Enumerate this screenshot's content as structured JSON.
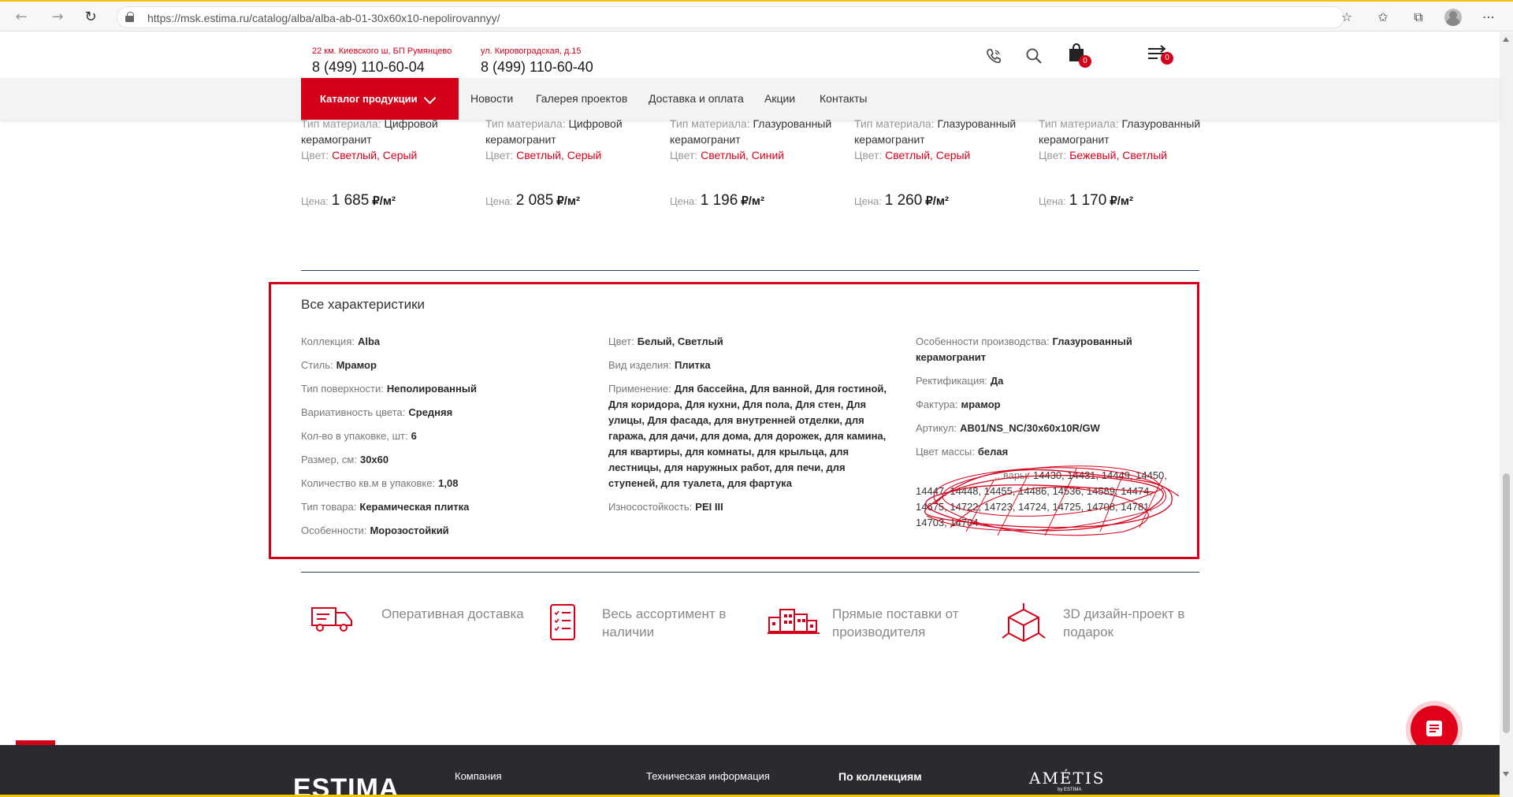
{
  "browser": {
    "url": "https://msk.estima.ru/catalog/alba/alba-ab-01-30x60x10-nepolirovannyy/"
  },
  "header": {
    "store1_address": "22 км. Киевского ш, БП Румянцево",
    "store1_phone": "8 (499) 110-60-04",
    "store2_address": "ул. Кировоградская, д.15",
    "store2_phone": "8 (499) 110-60-40",
    "cart_count": "0",
    "compare_count": "0"
  },
  "nav": {
    "catalog_label": "Каталог продукции",
    "links": [
      "Новости",
      "Галерея проектов",
      "Доставка и оплата",
      "Акции",
      "Контакты"
    ]
  },
  "products": [
    {
      "material_label": "Тип материала:",
      "material": "Цифровой керамогранит",
      "color_label": "Цвет:",
      "color": "Светлый, Серый",
      "price_label": "Цена:",
      "price": "1 685",
      "unit": "₽/м²"
    },
    {
      "material_label": "Тип материала:",
      "material": "Цифровой керамогранит",
      "color_label": "Цвет:",
      "color": "Светлый, Серый",
      "price_label": "Цена:",
      "price": "2 085",
      "unit": "₽/м²"
    },
    {
      "material_label": "Тип материала:",
      "material": "Глазурованный керамогранит",
      "color_label": "Цвет:",
      "color": "Светлый, Синий",
      "price_label": "Цена:",
      "price": "1 196",
      "unit": "₽/м²"
    },
    {
      "material_label": "Тип материала:",
      "material": "Глазурованный керамогранит",
      "color_label": "Цвет:",
      "color": "Светлый, Серый",
      "price_label": "Цена:",
      "price": "1 260",
      "unit": "₽/м²"
    },
    {
      "material_label": "Тип материала:",
      "material": "Глазурованный керамогранит",
      "color_label": "Цвет:",
      "color": "Бежевый, Светлый",
      "price_label": "Цена:",
      "price": "1 170",
      "unit": "₽/м²"
    }
  ],
  "specs": {
    "title": "Все характеристики",
    "col1": [
      {
        "label": "Коллекция:",
        "value": "Alba"
      },
      {
        "label": "Стиль:",
        "value": "Мрамор"
      },
      {
        "label": "Тип поверхности:",
        "value": "Неполированный"
      },
      {
        "label": "Вариативность цвета:",
        "value": "Средняя"
      },
      {
        "label": "Кол-во в упаковке, шт:",
        "value": "6"
      },
      {
        "label": "Размер, см:",
        "value": "30x60"
      },
      {
        "label": "Количество кв.м в упаковке:",
        "value": "1,08"
      },
      {
        "label": "Тип товара:",
        "value": "Керамическая плитка"
      },
      {
        "label": "Особенности:",
        "value": "Морозостойкий"
      }
    ],
    "col2": [
      {
        "label": "Цвет:",
        "value": "Белый, Светлый"
      },
      {
        "label": "Вид изделия:",
        "value": "Плитка"
      },
      {
        "label": "Применение:",
        "value": "Для бассейна, Для ванной, Для гостиной, Для коридора, Для кухни, Для пола, Для стен, Для улицы, Для фасада, для внутренней отделки, для гаража, для дачи, для дома, для дорожек, для камина, для квартиры, для комнаты, для крыльца, для лестницы, для наружных работ, для печи, для ступеней, для туалета, для фартука"
      },
      {
        "label": "Износостойкость:",
        "value": "PEI III"
      }
    ],
    "col3": [
      {
        "label": "Особенности производства:",
        "value": "Глазурованный керамогранит"
      },
      {
        "label": "Ректификация:",
        "value": "Да"
      },
      {
        "label": "Фактура:",
        "value": "мрамор"
      },
      {
        "label": "Артикул:",
        "value": "AB01/NS_NC/30x60x10R/GW"
      },
      {
        "label": "Цвет массы:",
        "value": "белая"
      }
    ],
    "related_label": "...вары:",
    "related_value": "14430, 14431, 14449, 14450, 14447, 14448, 14455, 14486, 14536, 14589, 14474, 14675, 14722, 14723, 14724, 14725, 14708, 14781, 14703, 14704"
  },
  "features": [
    {
      "icon": "truck-icon",
      "text": "Оперативная доставка"
    },
    {
      "icon": "checklist-icon",
      "text": "Весь ассортимент в наличии"
    },
    {
      "icon": "factory-icon",
      "text": "Прямые поставки от производителя"
    },
    {
      "icon": "cube-3d-icon",
      "text": "3D дизайн-проект в подарок"
    }
  ],
  "footer": {
    "logo": "ESTIMA",
    "links": [
      "Компания",
      "Техническая информация",
      "По коллекциям"
    ],
    "partner_logo": "AMÉTIS",
    "partner_sub": "by ESTIMA"
  },
  "colors": {
    "accent": "#d4001a",
    "footer_bg": "#2a2b2f",
    "divider": "#2b3a67"
  }
}
